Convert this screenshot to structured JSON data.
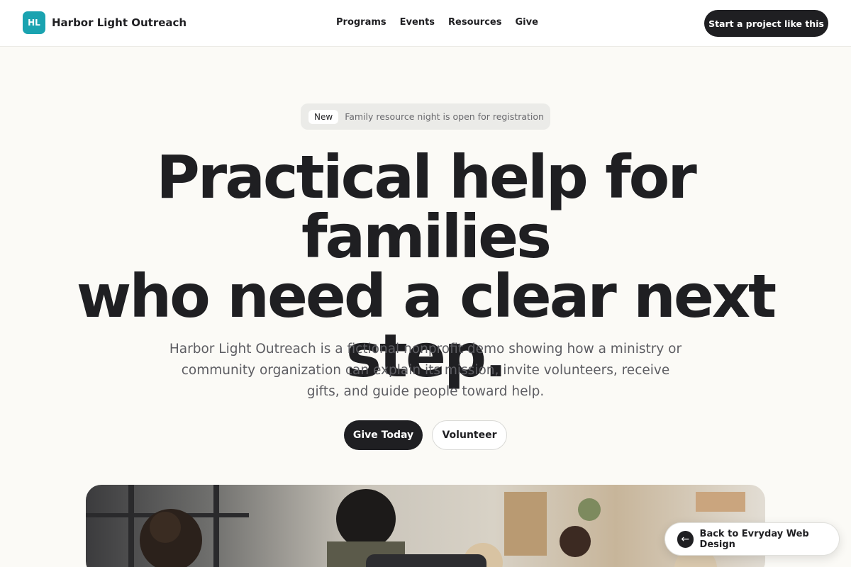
{
  "brand": {
    "logo_text": "HL",
    "name": "Harbor Light Outreach",
    "color": "#1aa3b0"
  },
  "nav": {
    "items": [
      "Programs",
      "Events",
      "Resources",
      "Give"
    ]
  },
  "header": {
    "cta_label": "Start a project like this"
  },
  "announcement": {
    "badge": "New",
    "text": "Family resource night is open for registration"
  },
  "hero": {
    "title_lines": [
      "Practical help for families",
      "who need a clear next",
      "step."
    ],
    "subtitle_lines": [
      "Harbor Light Outreach is a fictional nonprofit demo showing how a ministry or",
      "community organization can explain its mission, invite volunteers, receive",
      "gifts, and guide people toward help."
    ],
    "primary_button": "Give Today",
    "secondary_button": "Volunteer"
  },
  "floating": {
    "back_label": "Back to Evryday Web Design",
    "back_icon": "arrow-left-icon"
  },
  "colors": {
    "background": "#fbfaf6",
    "dark": "#1f1f22",
    "muted_text": "#5d5d62"
  }
}
